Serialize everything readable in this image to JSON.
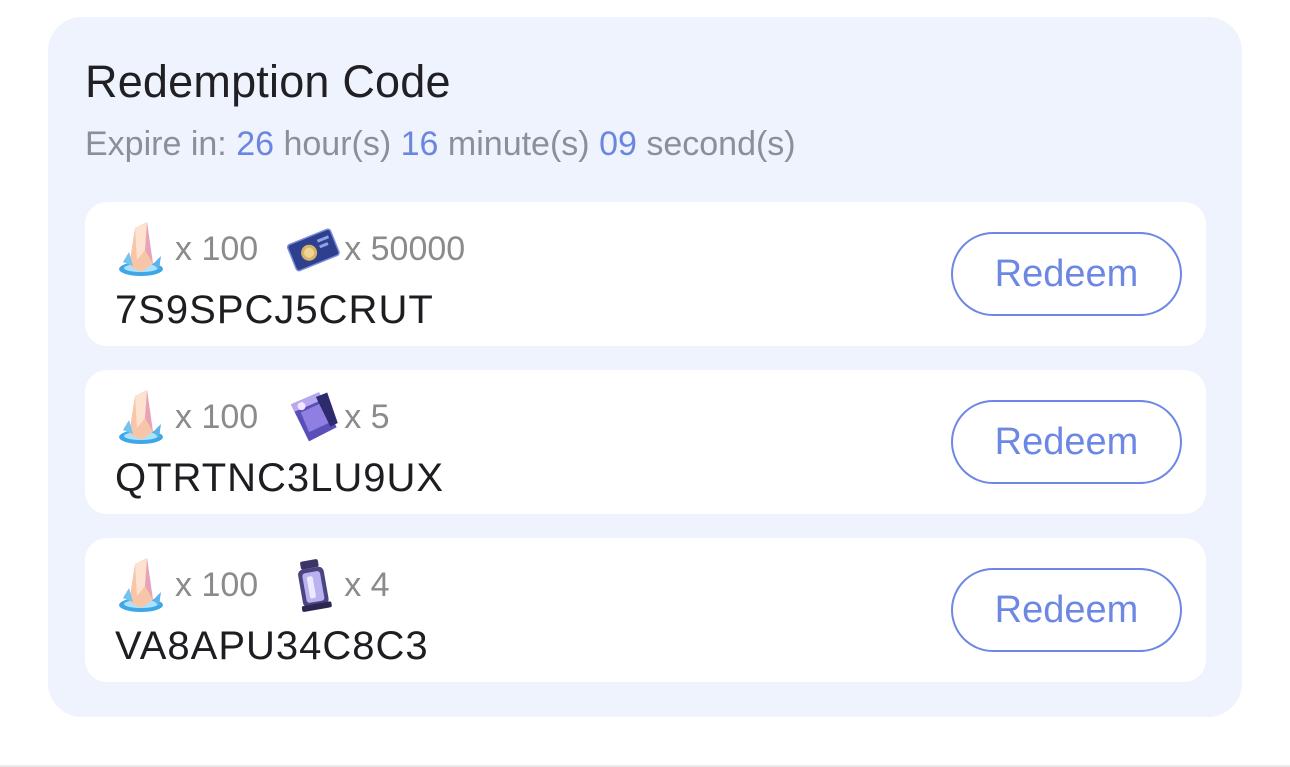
{
  "panel": {
    "title": "Redemption Code",
    "expire": {
      "prefix": "Expire in:",
      "hours": "26",
      "hours_label": "hour(s)",
      "minutes": "16",
      "minutes_label": "minute(s)",
      "seconds": "09",
      "seconds_label": "second(s)"
    }
  },
  "codes": [
    {
      "rewards": [
        {
          "icon": "stellar-jade-icon",
          "qty": "x 100"
        },
        {
          "icon": "credit-card-icon",
          "qty": "x 50000"
        }
      ],
      "code": "7S9SPCJ5CRUT",
      "button": "Redeem"
    },
    {
      "rewards": [
        {
          "icon": "stellar-jade-icon",
          "qty": "x 100"
        },
        {
          "icon": "exp-book-icon",
          "qty": "x 5"
        }
      ],
      "code": "QTRTNC3LU9UX",
      "button": "Redeem"
    },
    {
      "rewards": [
        {
          "icon": "stellar-jade-icon",
          "qty": "x 100"
        },
        {
          "icon": "lantern-bottle-icon",
          "qty": "x 4"
        }
      ],
      "code": "VA8APU34C8C3",
      "button": "Redeem"
    }
  ],
  "colors": {
    "panel_bg": "#eff3fd",
    "accent": "#6d88e4",
    "countdown_number": "#6a86e0",
    "muted_text": "#8a8f99"
  }
}
